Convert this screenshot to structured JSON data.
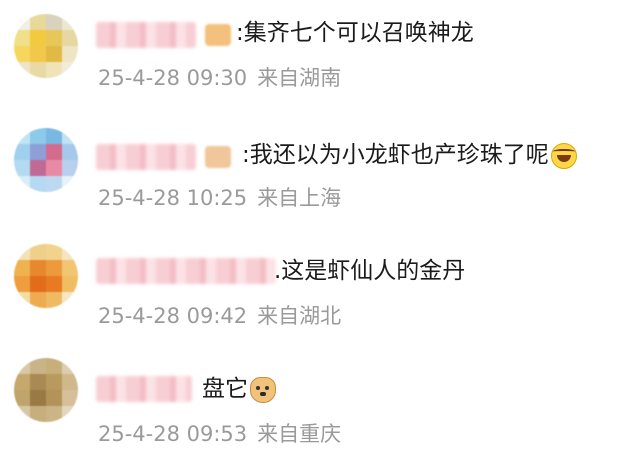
{
  "comments": [
    {
      "text": ":集齐七个可以召唤神龙",
      "time": "25-4-28 09:30",
      "location": "来自湖南",
      "avatar_colors": [
        "#f0f0e6",
        "#e8d89a",
        "#d8d2bf",
        "#ece7cf",
        "#f0e08a",
        "#f3c93f",
        "#e8c75a",
        "#e7d7a0",
        "#f6d65c",
        "#f2c84b",
        "#e1b945",
        "#efe5c2",
        "#ece4c8",
        "#e9d9a4",
        "#efe3b7",
        "#f2ecd8"
      ],
      "badge_color": "#f3c07d"
    },
    {
      "text": ":我还以为小龙虾也产珍珠了呢",
      "time": "25-4-28 10:25",
      "location": "来自上海",
      "emoji": "laughing-crying-emoji",
      "avatar_colors": [
        "#bfe4f4",
        "#8cc9ea",
        "#7ab8e4",
        "#c2e2f2",
        "#9fd1ef",
        "#8e9fd6",
        "#d46b8c",
        "#a6c8ea",
        "#b4daf1",
        "#c06b96",
        "#e88aa3",
        "#b9cfee",
        "#d8edf7",
        "#b5d9f2",
        "#bcd9f0",
        "#e6f2f9"
      ],
      "badge_color": "#f0c69a"
    },
    {
      "text": ".这是虾仙人的金丹",
      "time": "25-4-28 09:42",
      "location": "来自湖北",
      "avatar_colors": [
        "#f3e2b8",
        "#eed08a",
        "#f1d38c",
        "#f4e5c0",
        "#eeb24f",
        "#e8882e",
        "#ec9a3c",
        "#f1c673",
        "#ef9d3e",
        "#e26c1c",
        "#e87a24",
        "#f0bd62",
        "#f4dca5",
        "#eeab4f",
        "#efbb62",
        "#f6e7c4"
      ],
      "badge_color": "#f6d0d4"
    },
    {
      "text": "盘它",
      "time": "25-4-28 09:53",
      "location": "来自重庆",
      "emoji": "doge-emoji",
      "avatar_colors": [
        "#d7c8a6",
        "#c9b48a",
        "#c8ae79",
        "#dccdb0",
        "#c6a86d",
        "#a88a52",
        "#b8995e",
        "#cfb88a",
        "#bfa46c",
        "#9a7a44",
        "#b39358",
        "#d5c09a",
        "#d8c7a4",
        "#c7ae7c",
        "#cbb486",
        "#e2d6bf"
      ],
      "badge_color": "#f6d0d4"
    }
  ]
}
